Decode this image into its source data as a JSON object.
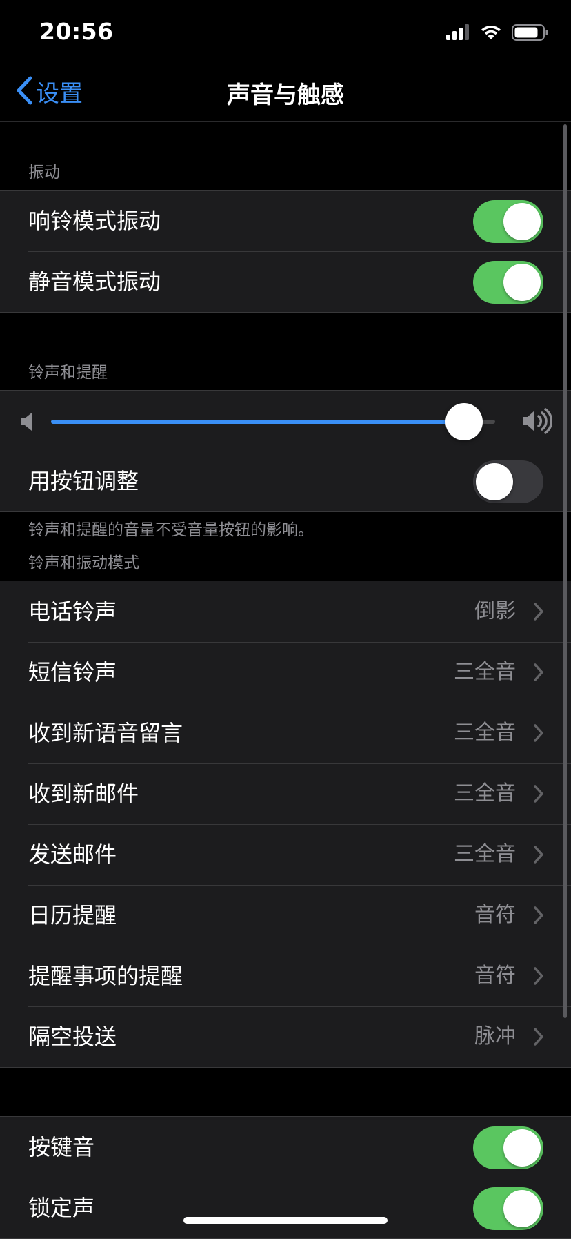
{
  "status_bar": {
    "time": "20:56",
    "icons": [
      "signal-icon",
      "wifi-icon",
      "battery-icon"
    ]
  },
  "nav": {
    "back_label": "设置",
    "title": "声音与触感"
  },
  "sections": {
    "vibration": {
      "header": "振动",
      "rows": [
        {
          "label": "响铃模式振动",
          "toggle": true
        },
        {
          "label": "静音模式振动",
          "toggle": true
        }
      ]
    },
    "ringer": {
      "header": "铃声和提醒",
      "volume_level": 0.93,
      "buttons_row": {
        "label": "用按钮调整",
        "toggle": false
      },
      "footer": "铃声和提醒的音量不受音量按钮的影响。"
    },
    "patterns": {
      "header": "铃声和振动模式",
      "rows": [
        {
          "label": "电话铃声",
          "value": "倒影"
        },
        {
          "label": "短信铃声",
          "value": "三全音"
        },
        {
          "label": "收到新语音留言",
          "value": "三全音"
        },
        {
          "label": "收到新邮件",
          "value": "三全音"
        },
        {
          "label": "发送邮件",
          "value": "三全音"
        },
        {
          "label": "日历提醒",
          "value": "音符"
        },
        {
          "label": "提醒事项的提醒",
          "value": "音符"
        },
        {
          "label": "隔空投送",
          "value": "脉冲"
        }
      ]
    },
    "system": {
      "rows": [
        {
          "label": "按键音",
          "toggle": true
        },
        {
          "label": "锁定声",
          "toggle": true
        }
      ]
    }
  },
  "colors": {
    "accent": "#3a8ff6",
    "toggle_on": "#5ac660",
    "cell_bg": "#1c1c1e",
    "secondary_text": "#8e8e93"
  }
}
